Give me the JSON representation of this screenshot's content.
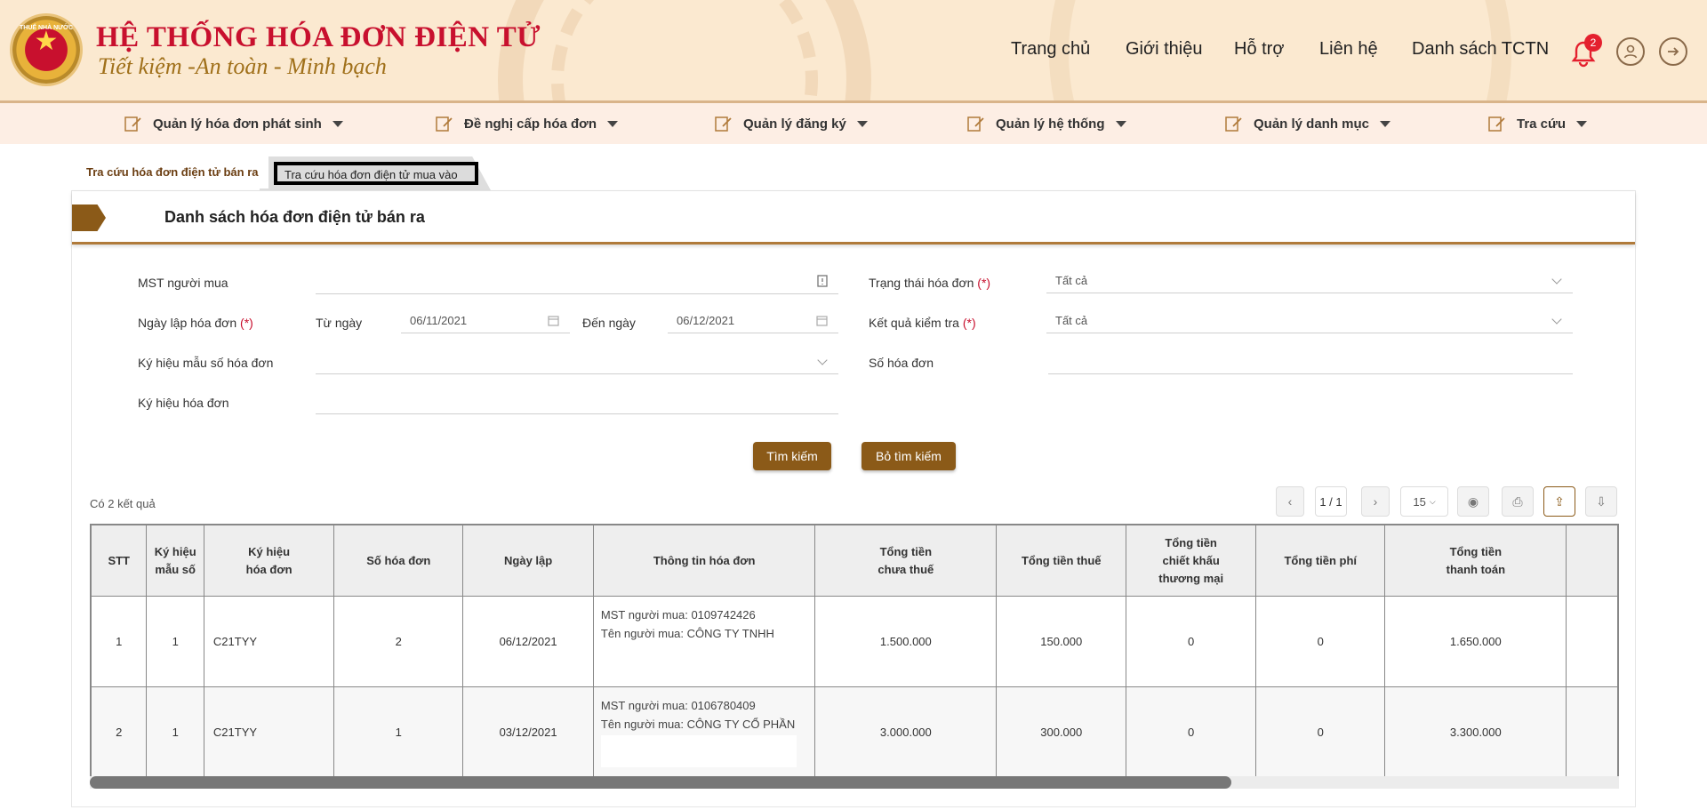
{
  "header": {
    "logo_text": "THUẾ NHÀ NƯỚC",
    "title": "HỆ THỐNG HÓA ĐƠN ĐIỆN TỬ",
    "slogan": "Tiết kiệm -An toàn - Minh bạch",
    "nav": [
      "Trang chủ",
      "Giới thiệu",
      "Hỗ trợ",
      "Liên hệ",
      "Danh sách TCTN"
    ],
    "notification_count": "2"
  },
  "menu": [
    "Quản lý hóa đơn phát sinh",
    "Đề nghị cấp hóa đơn",
    "Quản lý đăng ký",
    "Quản lý hệ thống",
    "Quản lý danh mục",
    "Tra cứu"
  ],
  "tabs": {
    "active": "Tra cứu hóa đơn điện tử bán ra",
    "inactive": "Tra cứu hóa đơn điện tử mua vào"
  },
  "panel": {
    "title": "Danh sách hóa đơn điện tử bán ra"
  },
  "form": {
    "mst_label": "MST người mua",
    "mst_value": "",
    "date_label": "Ngày lập hóa đơn",
    "required_mark": "(*)",
    "from_label": "Từ ngày",
    "from_value": "06/11/2021",
    "to_label": "Đến ngày",
    "to_value": "06/12/2021",
    "form_symbol_label": "Ký hiệu mẫu số hóa đơn",
    "invoice_symbol_label": "Ký hiệu hóa đơn",
    "status_label": "Trạng thái hóa đơn",
    "status_value": "Tất cả",
    "check_label": "Kết quả kiểm tra",
    "check_value": "Tất cả",
    "number_label": "Số hóa đơn",
    "search_button": "Tìm kiếm",
    "clear_button": "Bỏ tìm kiếm"
  },
  "results": {
    "count_text": "Có 2 kết quả",
    "page_text": "1 / 1",
    "page_size": "15"
  },
  "table": {
    "headers": [
      [
        "STT"
      ],
      [
        "Ký hiệu",
        "mẫu số"
      ],
      [
        "Ký hiệu",
        "hóa đơn"
      ],
      [
        "Số hóa đơn"
      ],
      [
        "Ngày lập"
      ],
      [
        "Thông tin hóa đơn"
      ],
      [
        "Tổng tiền",
        "chưa thuế"
      ],
      [
        "Tổng tiền thuế"
      ],
      [
        "Tổng tiền",
        "chiết khấu",
        "thương mại"
      ],
      [
        "Tổng tiền phí"
      ],
      [
        "Tổng tiền",
        "thanh toán"
      ]
    ],
    "rows": [
      {
        "stt": "1",
        "form": "1",
        "symbol": "C21TYY",
        "number": "2",
        "date": "06/12/2021",
        "info_mst": "MST người mua: 0109742426",
        "info_name": "Tên người mua: CÔNG TY TNHH",
        "pre_tax": "1.500.000",
        "tax": "150.000",
        "discount": "0",
        "fee": "0",
        "total": "1.650.000"
      },
      {
        "stt": "2",
        "form": "1",
        "symbol": "C21TYY",
        "number": "1",
        "date": "03/12/2021",
        "info_mst": "MST người mua: 0106780409",
        "info_name": "Tên người mua: CÔNG TY CỔ PHẦN",
        "pre_tax": "3.000.000",
        "tax": "300.000",
        "discount": "0",
        "fee": "0",
        "total": "3.300.000"
      }
    ]
  },
  "colors": {
    "brand_red": "#c8102e",
    "brand_brown": "#8b5a18",
    "header_bg": "#fbe9d0"
  }
}
